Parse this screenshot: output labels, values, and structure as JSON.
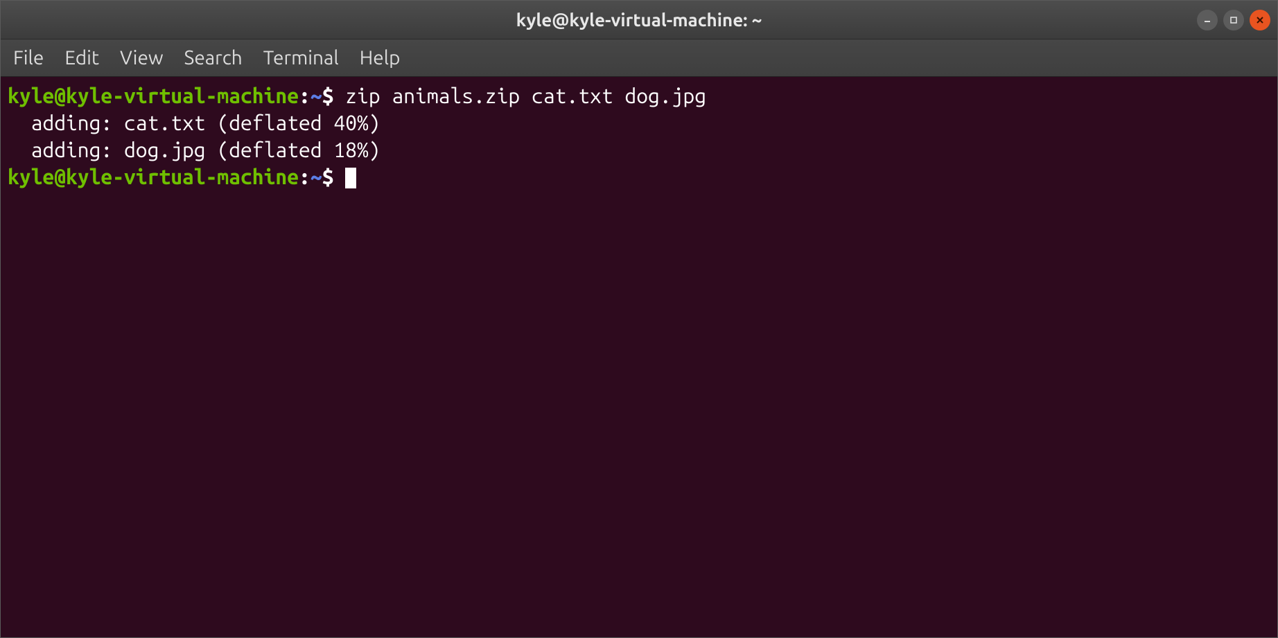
{
  "window": {
    "title": "kyle@kyle-virtual-machine: ~"
  },
  "menubar": {
    "items": [
      "File",
      "Edit",
      "View",
      "Search",
      "Terminal",
      "Help"
    ]
  },
  "terminal": {
    "lines": [
      {
        "prompt_user": "kyle@kyle-virtual-machine",
        "prompt_colon": ":",
        "prompt_path": "~",
        "prompt_dollar": "$",
        "command": " zip animals.zip cat.txt dog.jpg"
      },
      {
        "output": "  adding: cat.txt (deflated 40%)"
      },
      {
        "output": "  adding: dog.jpg (deflated 18%)"
      },
      {
        "prompt_user": "kyle@kyle-virtual-machine",
        "prompt_colon": ":",
        "prompt_path": "~",
        "prompt_dollar": "$",
        "command": " ",
        "cursor": true
      }
    ]
  }
}
